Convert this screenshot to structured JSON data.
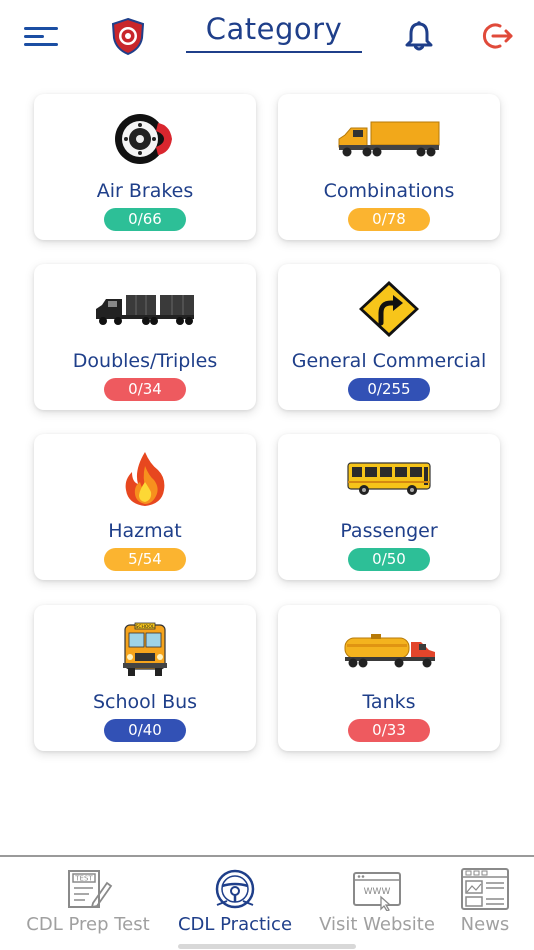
{
  "header": {
    "title": "Category"
  },
  "colors": {
    "primary": "#1f3f8a",
    "logout": "#e04a3a",
    "badge_teal": "#2dbf97",
    "badge_orange": "#fbb430",
    "badge_red": "#ee5a5f",
    "badge_blue": "#3251b5"
  },
  "categories": [
    {
      "label": "Air Brakes",
      "progress": "0/66",
      "icon": "brake-disc-icon"
    },
    {
      "label": "Combinations",
      "progress": "0/78",
      "icon": "semi-truck-icon"
    },
    {
      "label": "Doubles/Triples",
      "progress": "0/34",
      "icon": "double-trailer-truck-icon"
    },
    {
      "label": "General Commercial",
      "progress": "0/255",
      "icon": "curve-road-sign-icon"
    },
    {
      "label": "Hazmat",
      "progress": "5/54",
      "icon": "fire-icon"
    },
    {
      "label": "Passenger",
      "progress": "0/50",
      "icon": "passenger-bus-icon"
    },
    {
      "label": "School Bus",
      "progress": "0/40",
      "icon": "school-bus-icon"
    },
    {
      "label": "Tanks",
      "progress": "0/33",
      "icon": "tanker-truck-icon"
    }
  ],
  "school_bus_sign": "SCHOOL",
  "nav": {
    "items": [
      {
        "label": "CDL Prep Test",
        "icon": "test-clipboard-icon",
        "active": false,
        "icon_text": "TEST"
      },
      {
        "label": "CDL Practice",
        "icon": "steering-wheel-icon",
        "active": true
      },
      {
        "label": "Visit Website",
        "icon": "web-browser-icon",
        "active": false,
        "icon_text": "WWW"
      },
      {
        "label": "News",
        "icon": "newspaper-icon",
        "active": false
      }
    ]
  }
}
